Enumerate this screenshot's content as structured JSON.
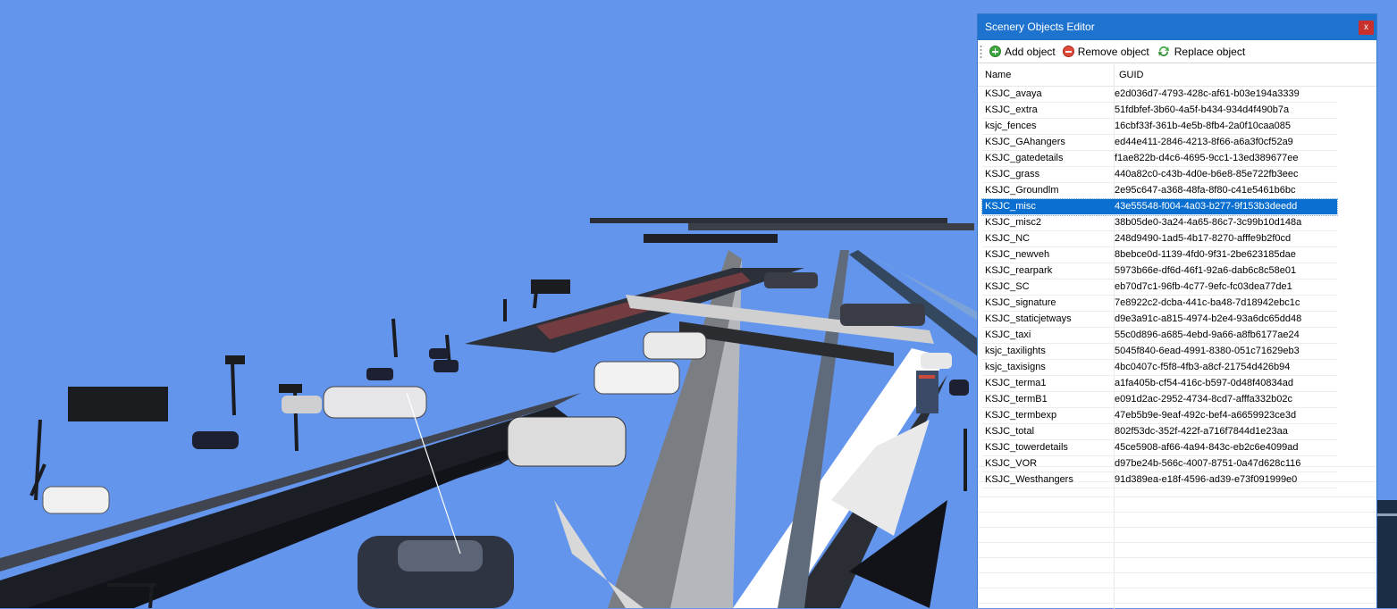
{
  "window": {
    "title": "Scenery Objects Editor",
    "close_label": "x"
  },
  "toolbar": {
    "add_label": "Add object",
    "remove_label": "Remove object",
    "replace_label": "Replace object"
  },
  "grid": {
    "columns": [
      "Name",
      "GUID"
    ],
    "selected_row": "KSJC_misc",
    "rows": [
      {
        "name": "KSJC_avaya",
        "guid": "e2d036d7-4793-428c-af61-b03e194a3339"
      },
      {
        "name": "KSJC_extra",
        "guid": "51fdbfef-3b60-4a5f-b434-934d4f490b7a"
      },
      {
        "name": "ksjc_fences",
        "guid": "16cbf33f-361b-4e5b-8fb4-2a0f10caa085"
      },
      {
        "name": "KSJC_GAhangers",
        "guid": "ed44e411-2846-4213-8f66-a6a3f0cf52a9"
      },
      {
        "name": "KSJC_gatedetails",
        "guid": "f1ae822b-d4c6-4695-9cc1-13ed389677ee"
      },
      {
        "name": "KSJC_grass",
        "guid": "440a82c0-c43b-4d0e-b6e8-85e722fb3eec"
      },
      {
        "name": "KSJC_Groundlm",
        "guid": "2e95c647-a368-48fa-8f80-c41e5461b6bc"
      },
      {
        "name": "KSJC_misc",
        "guid": "43e55548-f004-4a03-b277-9f153b3deedd"
      },
      {
        "name": "KSJC_misc2",
        "guid": "38b05de0-3a24-4a65-86c7-3c99b10d148a"
      },
      {
        "name": "KSJC_NC",
        "guid": "248d9490-1ad5-4b17-8270-afffe9b2f0cd"
      },
      {
        "name": "KSJC_newveh",
        "guid": "8bebce0d-1139-4fd0-9f31-2be623185dae"
      },
      {
        "name": "KSJC_rearpark",
        "guid": "5973b66e-df6d-46f1-92a6-dab6c8c58e01"
      },
      {
        "name": "KSJC_SC",
        "guid": "eb70d7c1-96fb-4c77-9efc-fc03dea77de1"
      },
      {
        "name": "KSJC_signature",
        "guid": "7e8922c2-dcba-441c-ba48-7d18942ebc1c"
      },
      {
        "name": "KSJC_staticjetways",
        "guid": "d9e3a91c-a815-4974-b2e4-93a6dc65dd48"
      },
      {
        "name": "KSJC_taxi",
        "guid": "55c0d896-a685-4ebd-9a66-a8fb6177ae24"
      },
      {
        "name": "ksjc_taxilights",
        "guid": "5045f840-6ead-4991-8380-051c71629eb3"
      },
      {
        "name": "ksjc_taxisigns",
        "guid": "4bc0407c-f5f8-4fb3-a8cf-21754d426b94"
      },
      {
        "name": "KSJC_terma1",
        "guid": "a1fa405b-cf54-416c-b597-0d48f40834ad"
      },
      {
        "name": "KSJC_termB1",
        "guid": "e091d2ac-2952-4734-8cd7-afffa332b02c"
      },
      {
        "name": "KSJC_termbexp",
        "guid": "47eb5b9e-9eaf-492c-bef4-a6659923ce3d"
      },
      {
        "name": "KSJC_total",
        "guid": "802f53dc-352f-422f-a716f7844d1e23aa"
      },
      {
        "name": "KSJC_towerdetails",
        "guid": "45ce5908-af66-4a94-843c-eb2c6e4099ad"
      },
      {
        "name": "KSJC_VOR",
        "guid": "d97be24b-566c-4007-8751-0a47d628c116"
      },
      {
        "name": "KSJC_Westhangers",
        "guid": "91d389ea-e18f-4596-ad39-e73f091999e0"
      }
    ]
  },
  "colors": {
    "sky": "#6495ed",
    "titlebar": "#1e73cf",
    "selection": "#0a6fd1",
    "close_button": "#c9302c"
  }
}
